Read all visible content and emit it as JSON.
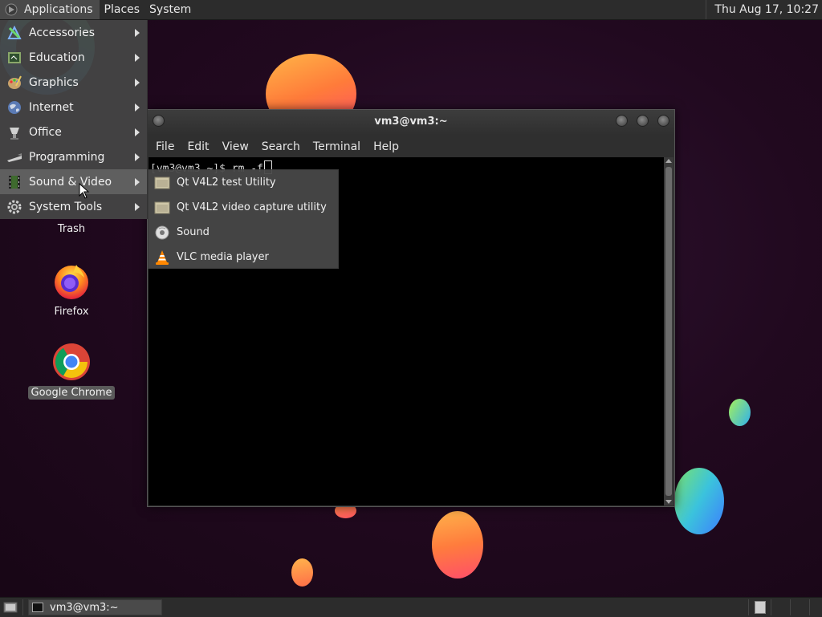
{
  "top_panel": {
    "applications": "Applications",
    "places": "Places",
    "system": "System",
    "clock": "Thu Aug 17, 10:27"
  },
  "app_menu": {
    "items": [
      {
        "label": "Accessories",
        "icon": "accessories-icon"
      },
      {
        "label": "Education",
        "icon": "education-icon"
      },
      {
        "label": "Graphics",
        "icon": "graphics-icon"
      },
      {
        "label": "Internet",
        "icon": "internet-globe-icon"
      },
      {
        "label": "Office",
        "icon": "office-icon"
      },
      {
        "label": "Programming",
        "icon": "programming-icon"
      },
      {
        "label": "Sound & Video",
        "icon": "sound-video-icon",
        "active": true
      },
      {
        "label": "System Tools",
        "icon": "system-tools-gear-icon"
      }
    ]
  },
  "submenu": {
    "items": [
      {
        "label": "Qt V4L2 test Utility",
        "icon": "generic-app-icon"
      },
      {
        "label": "Qt V4L2 video capture utility",
        "icon": "generic-app-icon"
      },
      {
        "label": "Sound",
        "icon": "sound-icon"
      },
      {
        "label": "VLC media player",
        "icon": "vlc-cone-icon"
      }
    ]
  },
  "terminal": {
    "title": "vm3@vm3:~",
    "menu": [
      "File",
      "Edit",
      "View",
      "Search",
      "Terminal",
      "Help"
    ],
    "prompt_line": "[vm3@vm3 ~]$ rm -f"
  },
  "desktop_icons": {
    "trash": "Trash",
    "firefox": "Firefox",
    "chrome": "Google Chrome"
  },
  "bottom_panel": {
    "task_label": "vm3@vm3:~"
  },
  "colors": {
    "panel_bg": "#2c2c2c",
    "menu_bg": "#444444",
    "desktop_bg": "#21091f"
  }
}
